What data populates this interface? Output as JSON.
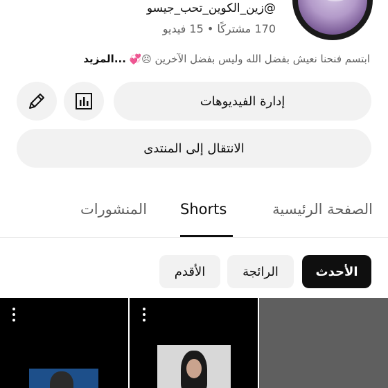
{
  "channel": {
    "handle": "@زين_الكوين_تحب_جيسو",
    "stats": "170 مشتركًا • 15 فيديو",
    "bio": "ابتسم فنحنا نعيش بفضل الله وليس بفضل الآخرين",
    "bio_emoji": "😣💞",
    "bio_more": "...المزيد"
  },
  "actions": {
    "manage_videos": "إدارة الفيديوهات",
    "go_to_community": "الانتقال إلى المنتدى"
  },
  "tabs": [
    {
      "label": "الصفحة الرئيسية",
      "active": false
    },
    {
      "label": "Shorts",
      "active": true
    },
    {
      "label": "المنشورات",
      "active": false
    }
  ],
  "sort_chips": [
    {
      "label": "الأحدث",
      "selected": true
    },
    {
      "label": "الرائجة",
      "selected": false
    },
    {
      "label": "الأقدم",
      "selected": false
    }
  ],
  "colors": {
    "text_primary": "#0f0f0f",
    "text_secondary": "#606060",
    "chip_bg": "#f2f2f2",
    "chip_selected_bg": "#0f0f0f"
  }
}
